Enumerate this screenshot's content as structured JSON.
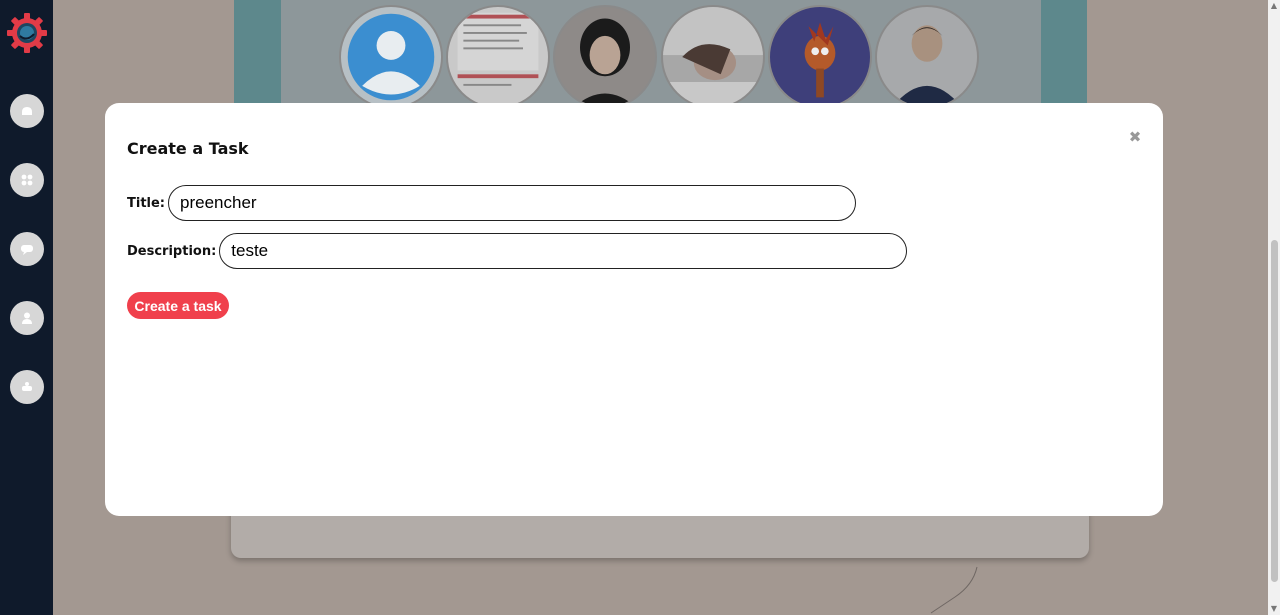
{
  "sidebar": {
    "items": [
      {
        "name": "home",
        "icon": "home-icon"
      },
      {
        "name": "dashboard",
        "icon": "grid-icon"
      },
      {
        "name": "chat",
        "icon": "chat-icon"
      },
      {
        "name": "profile",
        "icon": "user-icon"
      },
      {
        "name": "bot",
        "icon": "robot-icon"
      }
    ],
    "colors": {
      "background": "#0f1a2b",
      "logo": "#e23b47",
      "button": "#d7d7d7"
    }
  },
  "modal": {
    "title": "Create a Task",
    "close_icon": "close-icon",
    "fields": {
      "title_label": "Title:",
      "title_value": "preencher",
      "description_label": "Description:",
      "description_value": "teste"
    },
    "submit_label": "Create a task",
    "colors": {
      "accent": "#f0404c"
    }
  }
}
